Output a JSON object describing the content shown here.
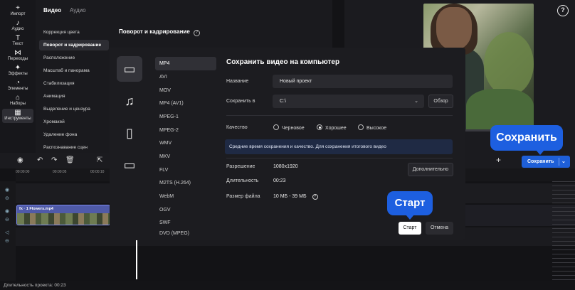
{
  "toolbar": {
    "items": [
      {
        "icon": "plus-icon",
        "glyph": "+",
        "label": "Импорт"
      },
      {
        "icon": "audio-icon",
        "glyph": "♪",
        "label": "Аудио"
      },
      {
        "icon": "text-icon",
        "glyph": "T",
        "label": "Текст"
      },
      {
        "icon": "transitions-icon",
        "glyph": "⋈",
        "label": "Переходы"
      },
      {
        "icon": "effects-icon",
        "glyph": "✦",
        "label": "Эффекты"
      },
      {
        "icon": "elements-icon",
        "glyph": "◔",
        "label": "Элементы"
      },
      {
        "icon": "sets-icon",
        "glyph": "⌂",
        "label": "Наборы"
      },
      {
        "icon": "tools-icon",
        "glyph": "▦",
        "label": "Инструменты"
      }
    ]
  },
  "props": {
    "tab_video": "Видео",
    "tab_audio": "Аудио",
    "menu": [
      "Коррекция цвета",
      "Поворот и кадрирование",
      "Расположение",
      "Масштаб и панорама",
      "Стабилизация",
      "Анимация",
      "Выделение и цензура",
      "Хромакей",
      "Удаление фона",
      "Распознавание сцен"
    ],
    "detail_title": "Поворот и кадрирование"
  },
  "preview": {
    "help": "?",
    "save_label": "Сохранить",
    "save_callout": "Сохранить"
  },
  "timeline": {
    "ticks": [
      "00:00:00",
      "00:00:05",
      "00:00:10"
    ],
    "clip_label": "fx · 1  Flowers.mp4",
    "status": "Длительность проекта: 00:23"
  },
  "dialog": {
    "title": "Сохранить видео на компьютер",
    "formats": [
      "MP4",
      "AVI",
      "MOV",
      "MP4 (AV1)",
      "MPEG-1",
      "MPEG-2",
      "WMV",
      "MKV",
      "FLV",
      "M2TS (H.264)",
      "WebM",
      "OGV",
      "SWF",
      "DVD (MPEG)"
    ],
    "name_label": "Название",
    "name_value": "Новый проект",
    "save_in_label": "Сохранить в",
    "save_in_value": "C:\\",
    "browse": "Обзор",
    "quality_label": "Качество",
    "quality_options": [
      "Черновое",
      "Хорошее",
      "Высокое"
    ],
    "quality_selected": "Хорошее",
    "info": "Средние время сохранения и качество. Для сохранения итогового видео",
    "resolution_label": "Разрешение",
    "resolution_value": "1080x1920",
    "advanced": "Дополнительно",
    "duration_label": "Длительность",
    "duration_value": "00:23",
    "filesize_label": "Размер файла",
    "filesize_value": "10 МБ - 39 МБ",
    "start": "Старт",
    "cancel": "Отмена",
    "start_callout": "Старт"
  },
  "colors": {
    "accent": "#1d5fe0",
    "background": "#131316"
  }
}
